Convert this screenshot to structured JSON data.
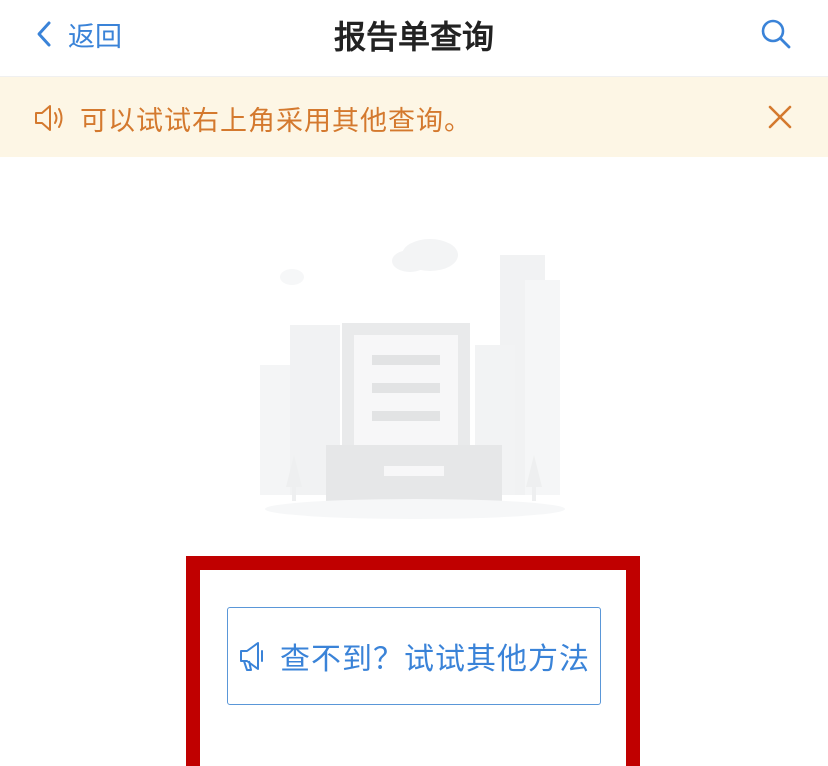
{
  "navbar": {
    "back_label": "返回",
    "title": "报告单查询",
    "search_icon": "search-icon"
  },
  "notice": {
    "icon": "speaker-icon",
    "text": "可以试试右上角采用其他查询。",
    "close_icon": "close-icon"
  },
  "empty_state": {
    "illustration": "empty-document-illustration"
  },
  "alt_button": {
    "icon": "megaphone-icon",
    "label": "查不到？试试其他方法"
  },
  "colors": {
    "accent": "#3a83d8",
    "notice_bg": "#fdf6e5",
    "notice_text": "#d4792e",
    "highlight": "#c00000"
  }
}
